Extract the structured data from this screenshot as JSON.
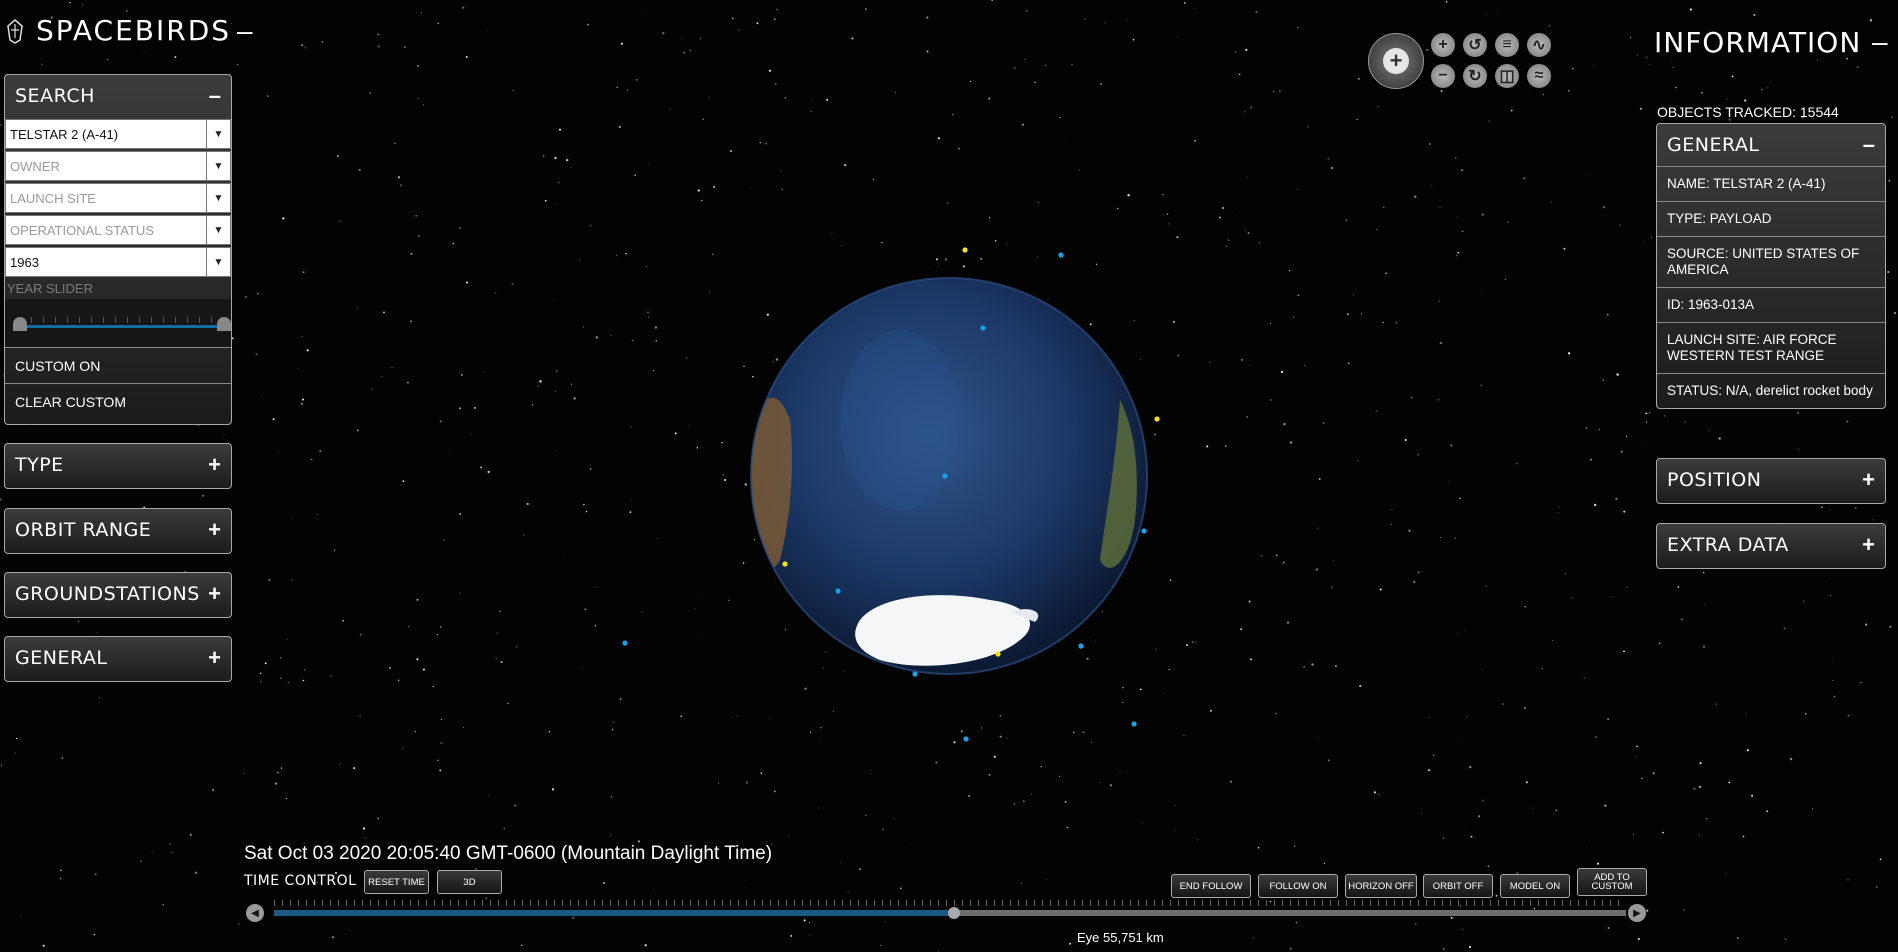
{
  "app": {
    "title": "SPACEBIRDS",
    "title_toggle": "–"
  },
  "search": {
    "header": "SEARCH",
    "toggle": "–",
    "name_value": "TELSTAR 2 (A-41)",
    "owner_placeholder": "OWNER",
    "launch_site_placeholder": "LAUNCH SITE",
    "status_placeholder": "OPERATIONAL STATUS",
    "year_value": "1963",
    "year_slider_label": "YEAR SLIDER",
    "custom_on": "CUSTOM ON",
    "clear_custom": "CLEAR CUSTOM"
  },
  "left_panels": [
    {
      "label": "TYPE",
      "toggle": "+"
    },
    {
      "label": "ORBIT RANGE",
      "toggle": "+"
    },
    {
      "label": "GROUNDSTATIONS",
      "toggle": "+"
    },
    {
      "label": "GENERAL",
      "toggle": "+"
    }
  ],
  "information": {
    "title": "INFORMATION",
    "toggle": "–",
    "objects_tracked": "OBJECTS TRACKED: 15544",
    "general": {
      "header": "GENERAL",
      "toggle": "–",
      "rows": [
        "NAME: TELSTAR 2 (A-41)",
        "TYPE: PAYLOAD",
        "SOURCE: UNITED STATES OF AMERICA",
        "ID: 1963-013A",
        "LAUNCH SITE: AIR FORCE WESTERN TEST RANGE",
        "STATUS: N/A, derelict rocket body"
      ]
    },
    "position": {
      "header": "POSITION",
      "toggle": "+"
    },
    "extra": {
      "header": "EXTRA DATA",
      "toggle": "+"
    }
  },
  "nav_controls": {
    "zoom_in": "+",
    "zoom_out": "−",
    "icons": [
      "zoom-in-icon",
      "rotate-left-icon",
      "layers-icon",
      "wave-icon",
      "zoom-out-icon",
      "rotate-right-icon",
      "audio-icon",
      "flatten-icon"
    ]
  },
  "time": {
    "datetime": "Sat Oct 03 2020 20:05:40 GMT-0600 (Mountain Daylight Time)",
    "control_label": "TIME CONTROL",
    "reset_time": "RESET TIME",
    "mode": "3D",
    "progress": 0.503
  },
  "view_buttons": {
    "end_follow": "END FOLLOW",
    "follow_on": "FOLLOW ON",
    "horizon_off": "HORIZON OFF",
    "orbit_off": "ORBIT OFF",
    "model_on": "MODEL ON",
    "add_to_custom": "ADD TO CUSTOM"
  },
  "eye": "Eye  55,751 km",
  "colors": {
    "accent": "#0f6fa3",
    "payload_dot": "#f2e31b",
    "debris_dot": "#1aa3e8"
  }
}
